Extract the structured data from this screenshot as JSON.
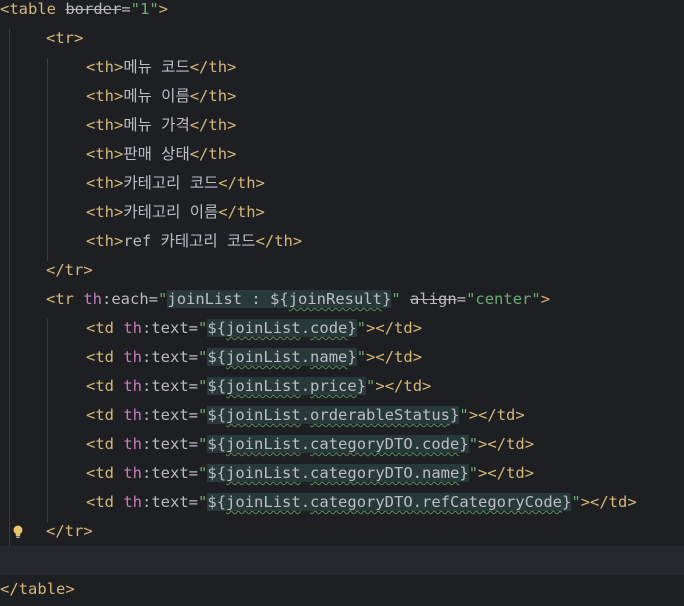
{
  "editor": {
    "lines": {
      "l1": {
        "open": "<table ",
        "attr": "border",
        "eq": "=",
        "val": "\"1\"",
        "close": ">"
      },
      "l2": {
        "tag": "<tr>"
      },
      "th": [
        {
          "open": "<th>",
          "text": "메뉴 코드",
          "close": "</th>"
        },
        {
          "open": "<th>",
          "text": "메뉴 이름",
          "close": "</th>"
        },
        {
          "open": "<th>",
          "text": "메뉴 가격",
          "close": "</th>"
        },
        {
          "open": "<th>",
          "text": "판매 상태",
          "close": "</th>"
        },
        {
          "open": "<th>",
          "text": "카테고리 코드",
          "close": "</th>"
        },
        {
          "open": "<th>",
          "text": "카테고리 이름",
          "close": "</th>"
        },
        {
          "open": "<th>",
          "text": "ref 카테고리 코드",
          "close": "</th>"
        }
      ],
      "l10": {
        "tag": "</tr>"
      },
      "l11": {
        "open": "<tr ",
        "ns": "th",
        "attr": ":each",
        "eq": "=",
        "q1": "\"",
        "expr_pre": "joinList : ${",
        "expr_ident": "joinResult",
        "expr_post": "}",
        "q2": "\"",
        "attr2": "align",
        "eq2": "=",
        "val2": "\"center\"",
        "close": ">"
      },
      "td": [
        {
          "prop": "code"
        },
        {
          "prop": "name"
        },
        {
          "prop": "price"
        },
        {
          "prop": "orderableStatus"
        },
        {
          "prop": "categoryDTO.code"
        },
        {
          "prop": "categoryDTO.name"
        },
        {
          "prop": "categoryDTO.refCategoryCode"
        }
      ],
      "td_parts": {
        "open": "<td ",
        "ns": "th",
        "attr": ":text",
        "eq": "=",
        "q": "\"",
        "tmpl_open": "${",
        "ident": "joinList",
        "dot": ".",
        "tmpl_close": "}",
        "close": "></td>"
      },
      "l19": {
        "tag": "</tr>"
      },
      "l21": {
        "tag": "</table>"
      }
    },
    "colors": {
      "background": "#1e1f22",
      "tag": "#d5b778",
      "string": "#6aab73",
      "namespace": "#c77dbb",
      "expression_bg": "#28393a"
    },
    "gutter_icon": "lightbulb-icon"
  }
}
